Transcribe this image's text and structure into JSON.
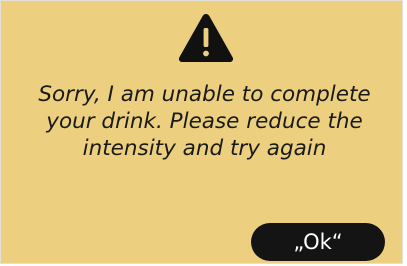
{
  "dialog": {
    "icon": "warning-triangle-icon",
    "message": "Sorry, I am unable to complete your drink. Please reduce the intensity and try again",
    "ok_label": "„Ok“"
  },
  "colors": {
    "background": "#ecd07f",
    "icon": "#111111",
    "button_background": "#141414",
    "button_text": "#ffffff",
    "text": "#1a1a1a"
  }
}
